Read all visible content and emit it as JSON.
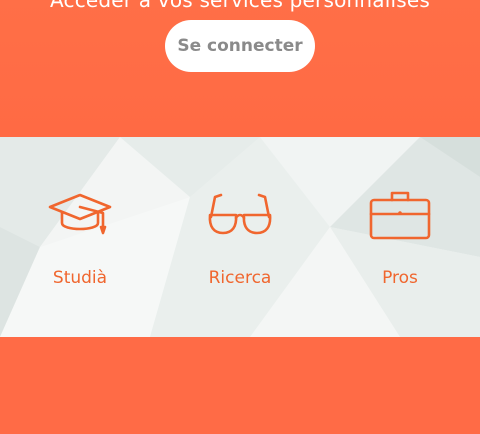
{
  "header": {
    "subtitle": "Accéder à vos services personnalisés",
    "connect_label": "Se connecter"
  },
  "tiles": [
    {
      "label": "Studià",
      "icon": "graduation-cap-icon"
    },
    {
      "label": "Ricerca",
      "icon": "glasses-icon"
    },
    {
      "label": "Pros",
      "icon": "briefcase-icon"
    }
  ],
  "colors": {
    "brand_orange": "#ff6b46",
    "icon_orange": "#f0662e",
    "band_bg": "#eef2f1",
    "button_text": "#8a8a8a"
  }
}
